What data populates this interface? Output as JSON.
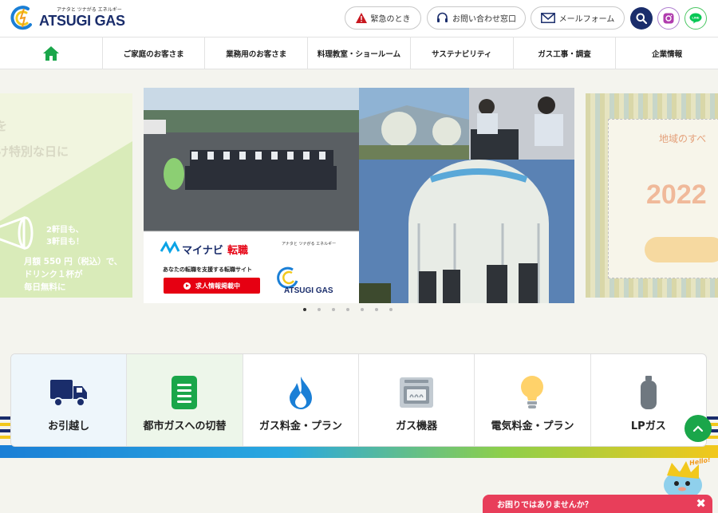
{
  "brand": {
    "name": "ATSUGI GAS",
    "tagline": "アナタと ツナがる エネルギー"
  },
  "header": {
    "emergency": "緊急のとき",
    "contact": "お問い合わせ窓口",
    "mail": "メールフォーム"
  },
  "nav": {
    "items": [
      "ご家庭のお客さま",
      "業務用のお客さま",
      "料理教室・ショールーム",
      "サステナビリティ",
      "ガス工事・調査",
      "企業情報"
    ]
  },
  "slides": {
    "left": {
      "line1": "を",
      "line2": "け特別な日に",
      "bubble1": "2軒目も、",
      "bubble2": "3軒目も！",
      "price1": "月額 550 円（税込）で、",
      "price2": "ドリンク１杯が",
      "price3": "毎日無料に"
    },
    "main": {
      "mynavi_brand": "マイナビ",
      "mynavi_suffix": "転職",
      "mynavi_desc": "あなたの転職を支援する転職サイト",
      "mynavi_button": "求人情報掲載中",
      "logo_tagline": "アナタと ツナがる エネルギー",
      "logo_name": "ATSUGI GAS"
    },
    "right": {
      "text": "地域のすべ",
      "year": "2022"
    }
  },
  "carousel": {
    "dot_count": 7,
    "active_index": 0
  },
  "services": [
    {
      "label": "お引越し",
      "icon": "truck-icon"
    },
    {
      "label": "都市ガスへの切替",
      "icon": "document-icon"
    },
    {
      "label": "ガス料金・プラン",
      "icon": "flame-icon"
    },
    {
      "label": "ガス機器",
      "icon": "stove-icon"
    },
    {
      "label": "電気料金・プラン",
      "icon": "lightbulb-icon"
    },
    {
      "label": "LPガス",
      "icon": "gas-cylinder-icon"
    }
  ],
  "help": {
    "text": "お困りではありませんか？",
    "close": "✖"
  },
  "mascot": {
    "hello": "Hello!"
  },
  "colors": {
    "navy": "#1a2d6b",
    "accent_green": "#1aa64a",
    "help_red": "#e83e5a",
    "brand_blue": "#1a7fd6"
  }
}
